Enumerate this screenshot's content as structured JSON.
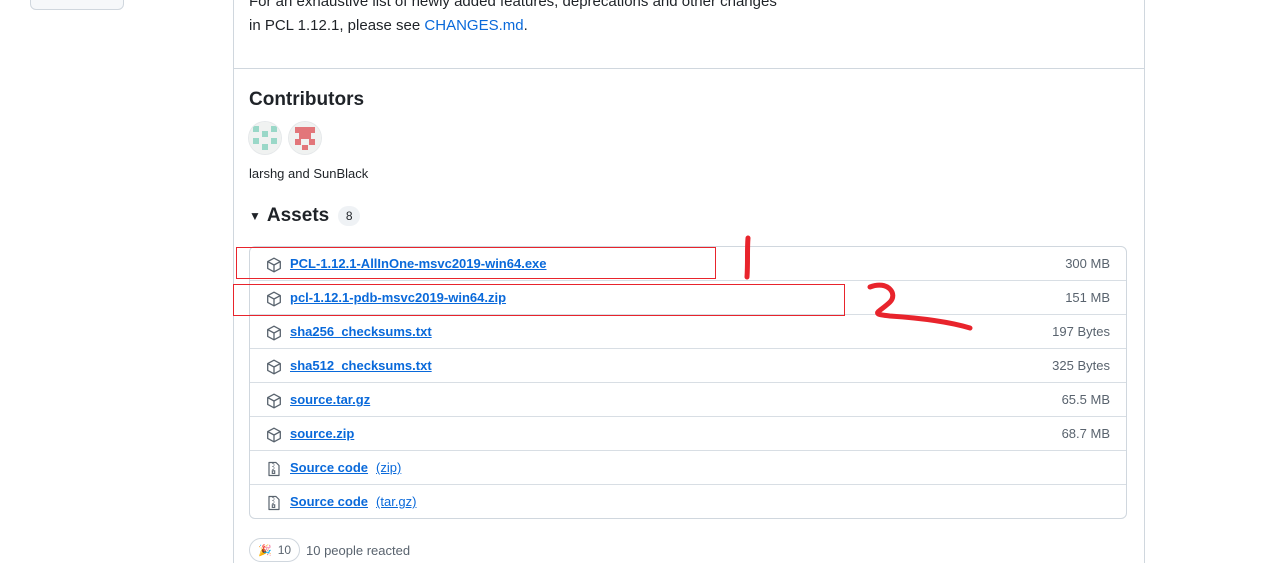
{
  "release_notes": {
    "line1": "For an exhaustive list of newly added features, deprecations and other changes",
    "line2_prefix": "in PCL 1.12.1, please see ",
    "changes_link": "CHANGES.md",
    "line2_suffix": "."
  },
  "contributors": {
    "title": "Contributors",
    "avatars": [
      "larshg",
      "SunBlack"
    ],
    "names_text": "larshg and SunBlack"
  },
  "assets": {
    "title": "Assets",
    "count": "8",
    "items": [
      {
        "name": "PCL-1.12.1-AllInOne-msvc2019-win64.exe",
        "size": "300 MB",
        "icon": "package-icon"
      },
      {
        "name": "pcl-1.12.1-pdb-msvc2019-win64.zip",
        "size": "151 MB",
        "icon": "package-icon"
      },
      {
        "name": "sha256_checksums.txt",
        "size": "197 Bytes",
        "icon": "package-icon"
      },
      {
        "name": "sha512_checksums.txt",
        "size": "325 Bytes",
        "icon": "package-icon"
      },
      {
        "name": "source.tar.gz",
        "size": "65.5 MB",
        "icon": "package-icon"
      },
      {
        "name": "source.zip",
        "size": "68.7 MB",
        "icon": "package-icon"
      },
      {
        "name": "Source code",
        "suffix": "(zip)",
        "size": "",
        "icon": "file-zip-icon"
      },
      {
        "name": "Source code",
        "suffix": "(tar.gz)",
        "size": "",
        "icon": "file-zip-icon"
      }
    ]
  },
  "reactions": {
    "emoji": "🎉",
    "count": "10",
    "summary": "10 people reacted"
  },
  "annotations": {
    "color": "#e8242c",
    "mark_1": "1",
    "mark_2": "2"
  },
  "colors": {
    "link": "#0969da",
    "border": "#d0d7de",
    "muted": "#59636e"
  }
}
